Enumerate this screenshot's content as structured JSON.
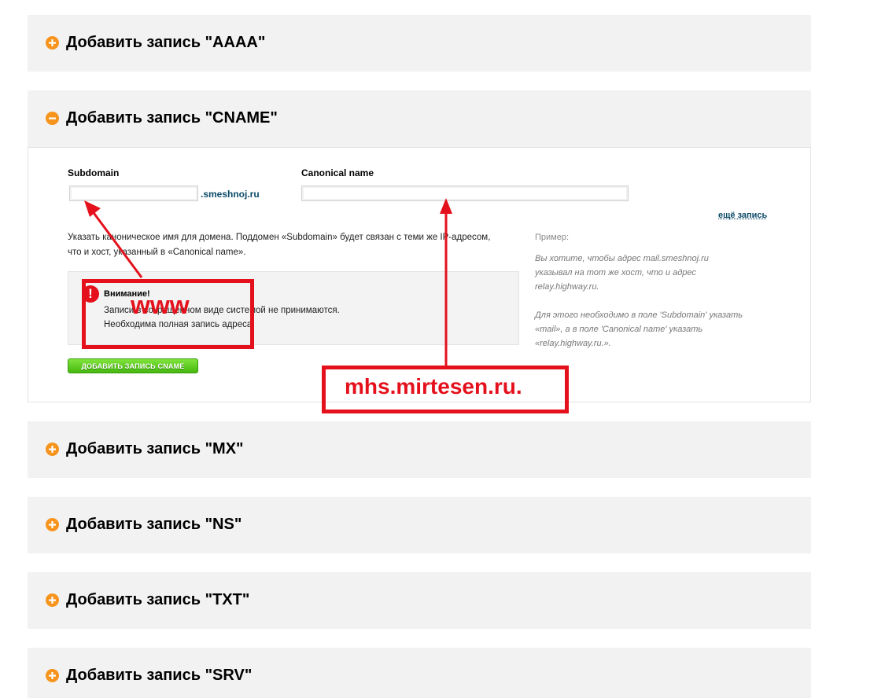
{
  "sections": {
    "aaaa": {
      "title": "Добавить запись \"AAAA\"",
      "icon": "plus-icon"
    },
    "cname": {
      "title": "Добавить запись \"CNAME\"",
      "icon": "minus-icon"
    },
    "mx": {
      "title": "Добавить запись \"MX\"",
      "icon": "plus-icon"
    },
    "ns": {
      "title": "Добавить запись \"NS\"",
      "icon": "plus-icon"
    },
    "txt": {
      "title": "Добавить запись \"TXT\"",
      "icon": "plus-icon"
    },
    "srv": {
      "title": "Добавить запись \"SRV\"",
      "icon": "plus-icon"
    }
  },
  "cname_form": {
    "subdomain_label": "Subdomain",
    "subdomain_value": "",
    "domain_suffix": ".smeshnoj.ru",
    "canonical_label": "Canonical name",
    "canonical_value": "",
    "more_link": "ещё запись",
    "description_line1": "Указать каноническое имя для домена. Поддомен «Subdomain» будет связан с теми же IP-адресом,",
    "description_line2": "что и хост, указанный в «Canonical name».",
    "example_title": "Пример:",
    "example_line1": "Вы хотите, чтобы адрес mail.smeshnoj.ru",
    "example_line2": "указывал на тот же хост, что и адрес",
    "example_line3": "relay.highway.ru.",
    "example_line4": "Для этого необходимо в поле 'Subdomain' указать",
    "example_line5": "«mail», а в поле 'Canonical name' указать",
    "example_line6": "«relay.highway.ru.».",
    "warning_title": "Внимание!",
    "warning_line1": "Записи в сокращённом виде системой не принимаются.",
    "warning_line2": "Необходима полная запись адреса.",
    "submit_label": "ДОБАВИТЬ ЗАПИСЬ CNAME"
  },
  "annotations": {
    "www_label": "www",
    "target_label": "mhs.mirtesen.ru.",
    "color": "#e4111c"
  },
  "colors": {
    "accent": "#f7941d",
    "link": "#0b4a68",
    "button": "#46b80f"
  }
}
